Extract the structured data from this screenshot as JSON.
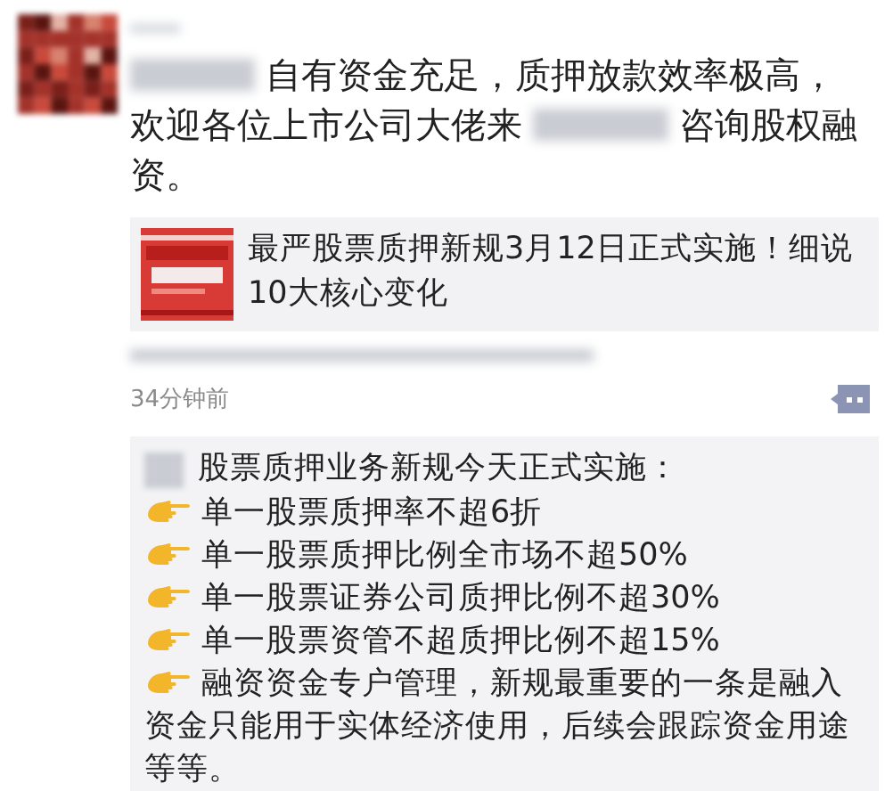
{
  "post": {
    "line_1": "自有资金充足，质押放款效率极高，",
    "line_2_before_blur": "欢迎各位上市公司大佬来",
    "line_2_after_blur": "咨询股权融",
    "line_3": "资。"
  },
  "link_card": {
    "title": "最严股票质押新规3月12日正式实施！细说10大核心变化"
  },
  "time": "34分钟前",
  "comment": {
    "heading": "股票质押业务新规今天正式实施：",
    "items": [
      "单一股票质押率不超6折",
      "单一股票质押比例全市场不超50%",
      "单一股票证券公司质押比例不超30%",
      "单一股票资管不超质押比例不超15%",
      "融资资金专户管理，新规最重要的一条是融入"
    ],
    "continuation": "资金只能用于实体经济使用，后续会跟踪资金用途等等。"
  }
}
